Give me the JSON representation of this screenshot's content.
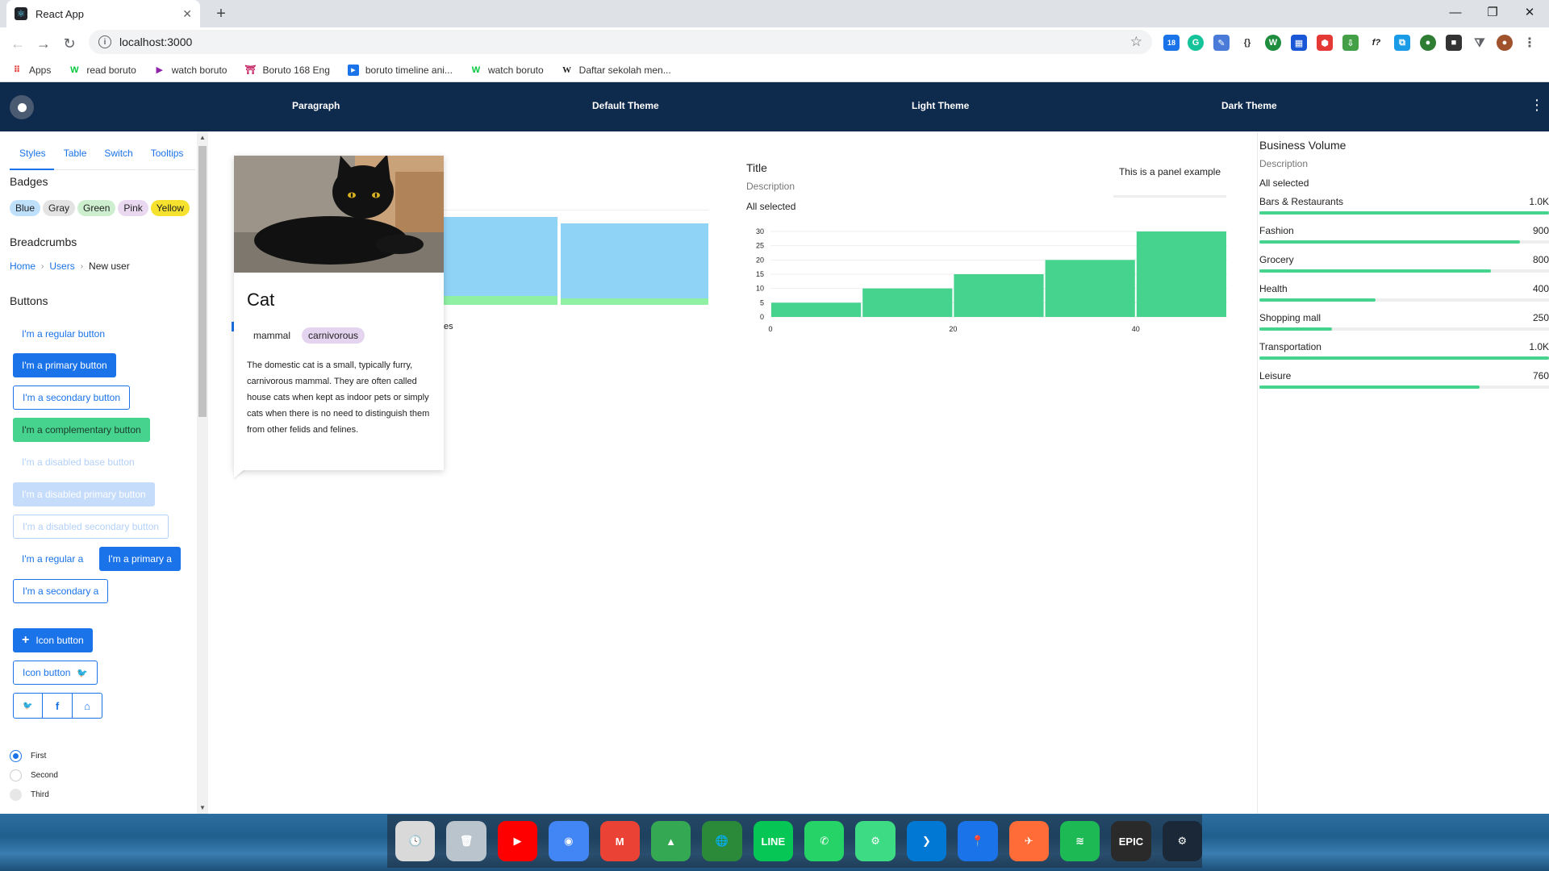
{
  "browser": {
    "tab_title": "React App",
    "tab_close": "✕",
    "new_tab": "+",
    "url": "localhost:3000",
    "bookmarks": [
      {
        "label": "Apps",
        "icon": "apps-grid-icon"
      },
      {
        "label": "read boruto",
        "icon": "webtoon-icon"
      },
      {
        "label": "watch boruto",
        "icon": "play-icon"
      },
      {
        "label": "Boruto 168 Eng",
        "icon": "site-icon"
      },
      {
        "label": "boruto timeline ani...",
        "icon": "bookmark-icon"
      },
      {
        "label": "watch boruto",
        "icon": "webtoon-icon"
      },
      {
        "label": "Daftar sekolah men...",
        "icon": "wiki-icon"
      }
    ],
    "extension_badge": "18"
  },
  "app": {
    "nav": [
      "Paragraph",
      "Default Theme",
      "Light Theme",
      "Dark Theme"
    ],
    "menu_icon": "⋮"
  },
  "sidebar": {
    "tabs": [
      "Styles",
      "Table",
      "Switch",
      "Tooltips"
    ],
    "badges_heading": "Badges",
    "badges": [
      {
        "label": "Blue",
        "color": "#bfe0fb"
      },
      {
        "label": "Gray",
        "color": "#e3e3e3"
      },
      {
        "label": "Green",
        "color": "#cdeecf"
      },
      {
        "label": "Pink",
        "color": "#e9d8f0"
      },
      {
        "label": "Yellow",
        "color": "#f5e12e"
      }
    ],
    "breadcrumbs_heading": "Breadcrumbs",
    "breadcrumbs": [
      "Home",
      "Users",
      "New user"
    ],
    "buttons_heading": "Buttons",
    "buttons": {
      "regular": "I'm a regular button",
      "primary": "I'm a primary button",
      "secondary": "I'm a secondary button",
      "complementary": "I'm a complementary button",
      "disabled_base": "I'm a disabled base button",
      "disabled_primary": "I'm a disabled primary button",
      "disabled_secondary": "I'm a disabled secondary button",
      "regular_a": "I'm a regular a",
      "primary_a": "I'm a primary a",
      "secondary_a": "I'm a secondary a",
      "icon_button_1": "Icon button",
      "icon_button_2": "Icon button",
      "plus": "+"
    },
    "social": [
      {
        "glyph": "🐦",
        "icon": "twitter-icon"
      },
      {
        "glyph": "f",
        "icon": "facebook-icon"
      },
      {
        "glyph": "⌂",
        "icon": "home-icon"
      }
    ],
    "radios": [
      {
        "label": "First",
        "checked": true
      },
      {
        "label": "Second",
        "checked": false
      },
      {
        "label": "Third",
        "checked": false
      }
    ]
  },
  "card": {
    "title": "Cat",
    "tags": [
      {
        "label": "mammal",
        "color": "#ffffff"
      },
      {
        "label": "carnivorous",
        "color": "#e4d4f0"
      }
    ],
    "body": "The domestic cat is a small, typically furry, carnivorous mammal. They are often called house cats when kept as indoor pets or simply cats when there is no need to distinguish them from other felids and felines.",
    "behind_text": "es"
  },
  "panel": {
    "title": "Title",
    "description": "Description",
    "selected": "All selected",
    "example": "This is a panel example"
  },
  "chart_data": [
    {
      "type": "bar",
      "note": "histogram",
      "x_ticks": [
        0,
        20,
        40
      ],
      "y_ticks": [
        0,
        5,
        10,
        15,
        20,
        25,
        30
      ],
      "bins": [
        {
          "x0": 0,
          "x1": 10,
          "value": 5
        },
        {
          "x0": 10,
          "x1": 20,
          "value": 10
        },
        {
          "x0": 20,
          "x1": 30,
          "value": 15
        },
        {
          "x0": 30,
          "x1": 40,
          "value": 20
        },
        {
          "x0": 40,
          "x1": 50,
          "value": 30
        }
      ],
      "xlim": [
        0,
        50
      ],
      "ylim": [
        0,
        30
      ],
      "color": "#46d38e"
    }
  ],
  "business": {
    "title": "Business Volume",
    "description": "Description",
    "selected": "All selected",
    "rows": [
      {
        "label": "Bars & Restaurants",
        "value": "1.0K",
        "fraction": 1.0
      },
      {
        "label": "Fashion",
        "value": "900",
        "fraction": 0.9
      },
      {
        "label": "Grocery",
        "value": "800",
        "fraction": 0.8
      },
      {
        "label": "Health",
        "value": "400",
        "fraction": 0.4
      },
      {
        "label": "Shopping mall",
        "value": "250",
        "fraction": 0.25
      },
      {
        "label": "Transportation",
        "value": "1.0K",
        "fraction": 1.0
      },
      {
        "label": "Leisure",
        "value": "760",
        "fraction": 0.76
      }
    ]
  },
  "dock": [
    {
      "name": "clock-app",
      "color": "#d9d9d9",
      "glyph": "🕓"
    },
    {
      "name": "trash",
      "color": "#b9c4cc",
      "glyph": "🗑"
    },
    {
      "name": "youtube",
      "color": "#ff0000",
      "glyph": "▶"
    },
    {
      "name": "chrome",
      "color": "#4285f4",
      "glyph": "◉"
    },
    {
      "name": "gmail",
      "color": "#ea4335",
      "glyph": "M"
    },
    {
      "name": "google-drive",
      "color": "#34a853",
      "glyph": "▲"
    },
    {
      "name": "internet-download-manager",
      "color": "#2a8a3a",
      "glyph": "🌐"
    },
    {
      "name": "line",
      "color": "#06c755",
      "glyph": "LINE"
    },
    {
      "name": "whatsapp",
      "color": "#25d366",
      "glyph": "✆"
    },
    {
      "name": "android-studio",
      "color": "#3ddc84",
      "glyph": "⚙"
    },
    {
      "name": "vscode",
      "color": "#0078d4",
      "glyph": "❯"
    },
    {
      "name": "maps-pin",
      "color": "#1a73e8",
      "glyph": "📍"
    },
    {
      "name": "postman",
      "color": "#ff6c37",
      "glyph": "✈"
    },
    {
      "name": "spotify",
      "color": "#1db954",
      "glyph": "≋"
    },
    {
      "name": "epic-games",
      "color": "#2a2a2a",
      "glyph": "EPIC"
    },
    {
      "name": "steam",
      "color": "#1b2838",
      "glyph": "⚙"
    }
  ]
}
